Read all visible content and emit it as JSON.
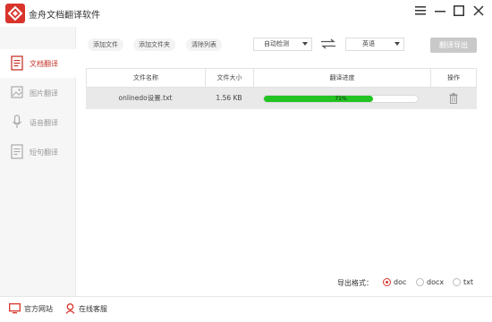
{
  "app": {
    "title": "金舟文档翻译软件",
    "brand_color": "#d9342b"
  },
  "window": {
    "menu_icon": "menu-icon",
    "minimize_icon": "minimize-icon",
    "maximize_icon": "maximize-icon",
    "close_icon": "close-icon"
  },
  "sidebar": {
    "items": [
      {
        "label": "文档翻译",
        "icon": "document-icon",
        "active": true
      },
      {
        "label": "图片翻译",
        "icon": "image-icon",
        "active": false
      },
      {
        "label": "语音翻译",
        "icon": "microphone-icon",
        "active": false
      },
      {
        "label": "短句翻译",
        "icon": "text-icon",
        "active": false
      }
    ]
  },
  "toolbar": {
    "add_file": "添加文件",
    "add_folder": "添加文件夹",
    "clear_list": "清除列表",
    "source_lang": "自动检测",
    "target_lang": "英语",
    "export_label": "翻译导出"
  },
  "table": {
    "headers": [
      "文件名称",
      "文件大小",
      "翻译进度",
      "操作"
    ],
    "rows": [
      {
        "name": "onlinedo设置.txt",
        "size": "1.56 KB",
        "progress_text": "71%",
        "progress": 0.71
      }
    ]
  },
  "export_format": {
    "label": "导出格式：",
    "options": [
      "doc",
      "docx",
      "txt"
    ],
    "selected": "doc"
  },
  "footer": {
    "website": "官方网站",
    "support": "在线客服"
  }
}
